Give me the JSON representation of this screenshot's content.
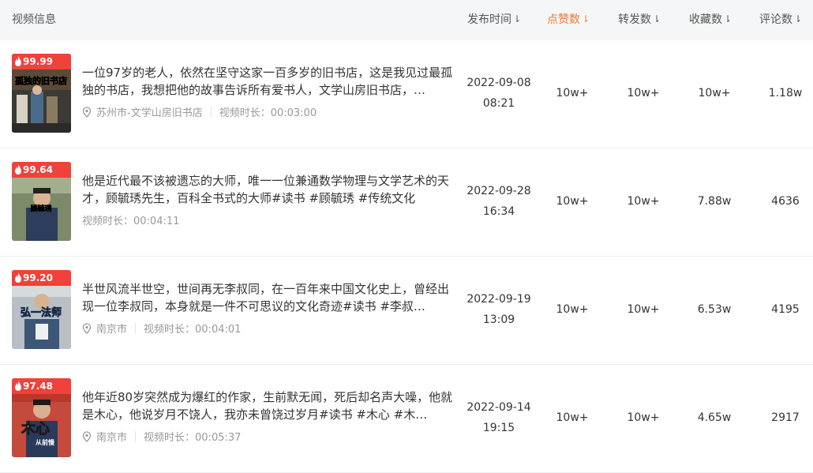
{
  "header": {
    "video_info": "视频信息",
    "publish_time": "发布时间",
    "likes": "点赞数",
    "shares": "转发数",
    "favorites": "收藏数",
    "comments": "评论数",
    "sort_glyph": "⇂"
  },
  "accent_color": "#f07a30",
  "badge_color": "#f0413a",
  "duration_label": "视频时长：",
  "rows": [
    {
      "score": "99.99",
      "title": "一位97岁的老人，依然在坚守这家一百多岁的旧书店，这是我见过最孤独的书店，我想把他的故事告诉所有爱书人，文学山房旧书店，…",
      "location": "苏州市-文学山房旧书店",
      "duration": "视频时长：00:03:00",
      "date": "2022-09-08",
      "time": "08:21",
      "likes": "10w+",
      "shares": "10w+",
      "favorites": "10w+",
      "comments": "1.18w",
      "thumb_text": "孤独的旧书店"
    },
    {
      "score": "99.64",
      "title": "他是近代最不该被遗忘的大师，唯一一位兼通数学物理与文学艺术的天才，顾毓琇先生，百科全书式的大师#读书 #顾毓琇 #传统文化",
      "location": "",
      "duration": "视频时长：00:04:11",
      "date": "2022-09-28",
      "time": "16:34",
      "likes": "10w+",
      "shares": "10w+",
      "favorites": "7.88w",
      "comments": "4636",
      "thumb_text": "顾毓琇"
    },
    {
      "score": "99.20",
      "title": "半世风流半世空，世间再无李叔同，在一百年来中国文化史上，曾经出现一位李叔同，本身就是一件不可思议的文化奇迹#读书 #李叔…",
      "location": "南京市",
      "duration": "视频时长：00:04:01",
      "date": "2022-09-19",
      "time": "13:09",
      "likes": "10w+",
      "shares": "10w+",
      "favorites": "6.53w",
      "comments": "4195",
      "thumb_text": "弘一法师"
    },
    {
      "score": "97.48",
      "title": "他年近80岁突然成为爆红的作家，生前默无闻，死后却名声大噪，他就是木心，他说岁月不饶人，我亦未曾饶过岁月#读书 #木心 #木…",
      "location": "南京市",
      "duration": "视频时长：00:05:37",
      "date": "2022-09-14",
      "time": "19:15",
      "likes": "10w+",
      "shares": "10w+",
      "favorites": "4.65w",
      "comments": "2917",
      "thumb_text": "木心",
      "thumb_sub": "从前慢"
    }
  ]
}
